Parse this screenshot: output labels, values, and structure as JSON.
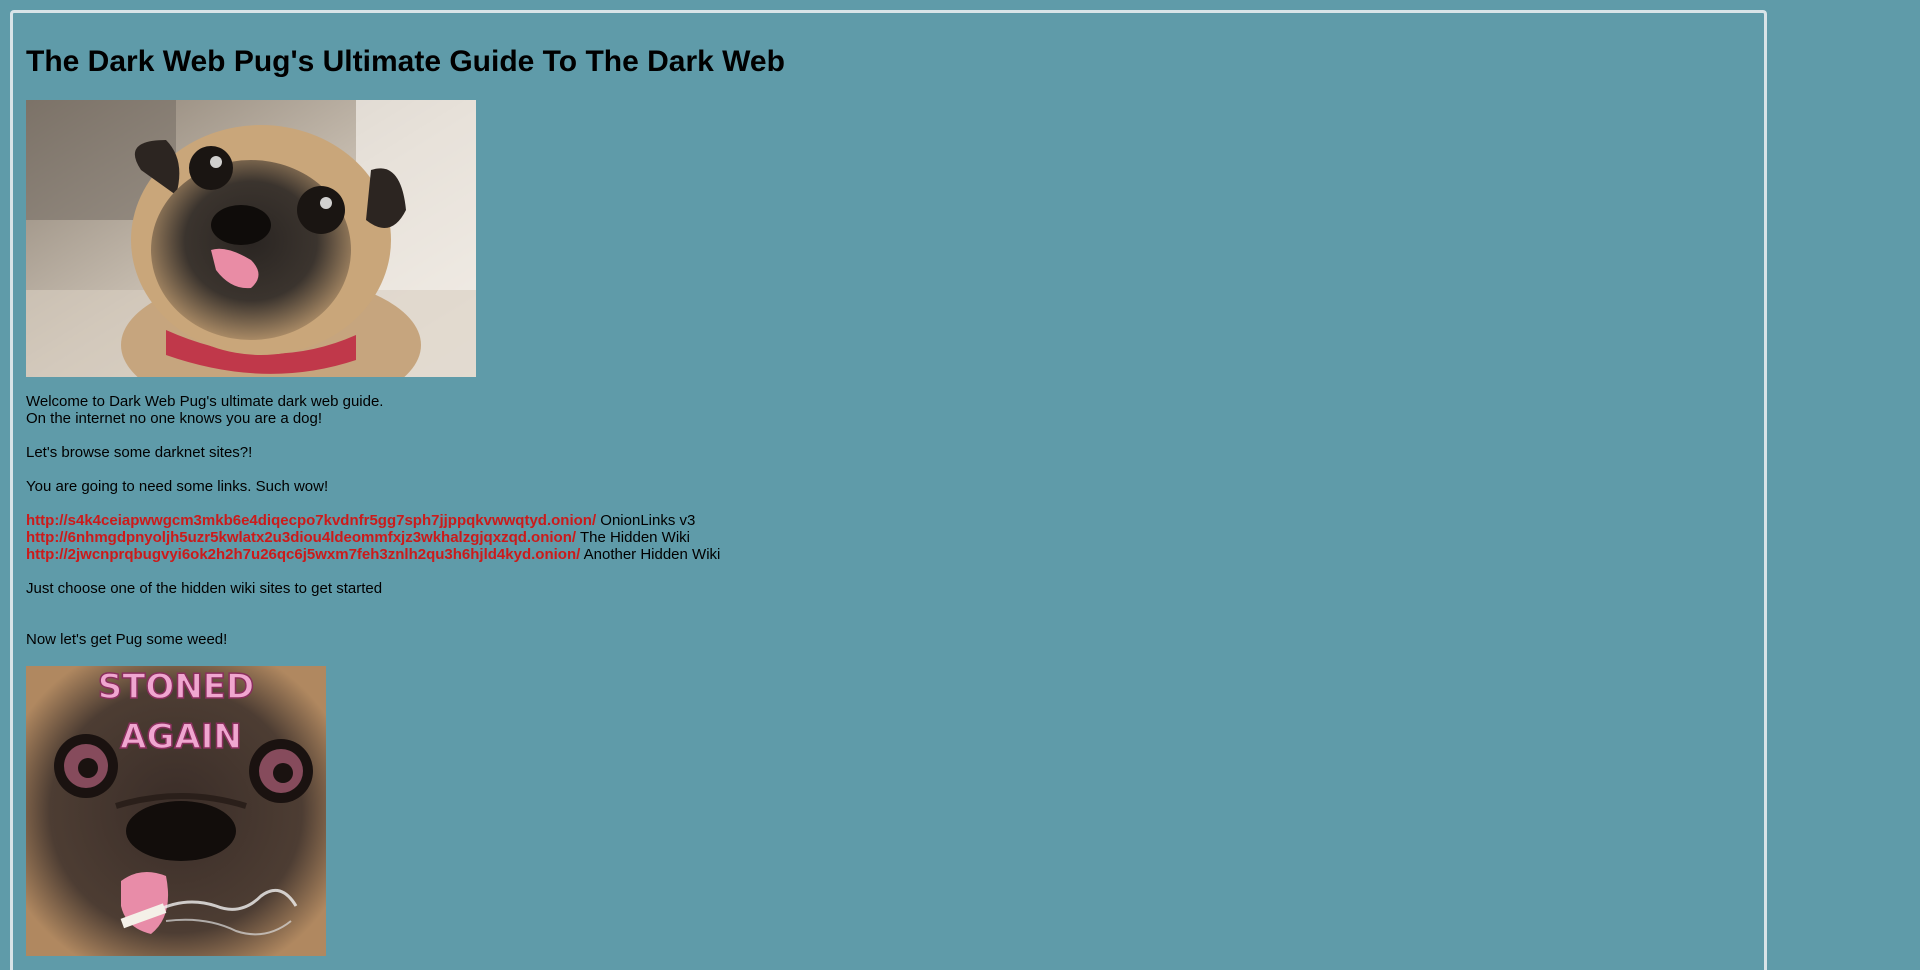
{
  "page": {
    "title": "The Dark Web Pug's Ultimate Guide To The Dark Web"
  },
  "intro": {
    "line1": "Welcome to Dark Web Pug's ultimate dark web guide.",
    "line2": "On the internet no one knows you are a dog!",
    "line3": "Let's browse some darknet sites?!",
    "line4": "You are going to need some links. Such wow!"
  },
  "links": [
    {
      "url": "http://s4k4ceiapwwgcm3mkb6e4diqecpo7kvdnfr5gg7sph7jjppqkvwwqtyd.onion/",
      "desc": "OnionLinks v3"
    },
    {
      "url": "http://6nhmgdpnyoljh5uzr5kwlatx2u3diou4ldeommfxjz3wkhalzgjqxzqd.onion/",
      "desc": "The Hidden Wiki"
    },
    {
      "url": "http://2jwcnprqbugvyi6ok2h2h7u26qc6j5wxm7feh3znlh2qu3h6hjld4kyd.onion/",
      "desc": "Another Hidden Wiki"
    }
  ],
  "outro": {
    "line1": "Just choose one of the hidden wiki sites to get started",
    "line2": "Now let's get Pug some weed!"
  },
  "images": {
    "pug_photo": "pug-photo",
    "stoned_photo_caption": "STONED AGAIN"
  },
  "colors": {
    "background": "#5f9ba9",
    "link": "#cc1a1a",
    "frame_border": "#d8e4e8"
  }
}
